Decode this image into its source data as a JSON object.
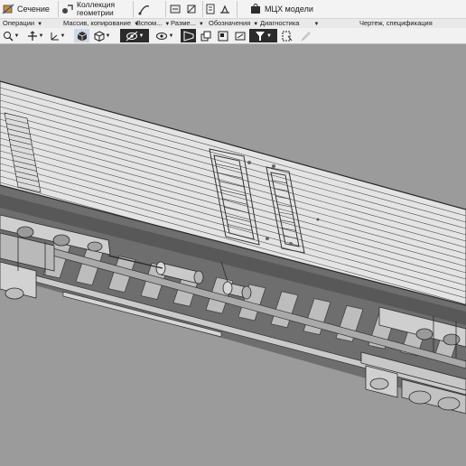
{
  "ribbon": {
    "section_label": "Сечение",
    "collection_label_line1": "Коллекция",
    "collection_label_line2": "геометрии",
    "mcx_label": "МЦХ модели"
  },
  "groups": {
    "operations": "Операции",
    "mass_copy": "Массив, копирование",
    "auxiliary": "Вспом...",
    "dimensions": "Разме...",
    "designations": "Обозначения",
    "diagnostics": "Диагностика",
    "drawing_spec": "Чертеж, спецификация"
  },
  "icons": {
    "section": "section-icon",
    "collection": "geometry-collection-icon",
    "curve": "curve-icon",
    "dimension": "dimension-icon",
    "measure": "measure-icon",
    "designation": "designation-icon",
    "weld": "weld-icon",
    "mcx": "mass-properties-icon"
  },
  "colors": {
    "ribbon_bg": "#f3f3f3",
    "viewport_bg": "#9b9b9b",
    "model_body": "#e2e2e2",
    "model_line": "#3a3a3a",
    "active_tool": "#2b2b2b"
  }
}
